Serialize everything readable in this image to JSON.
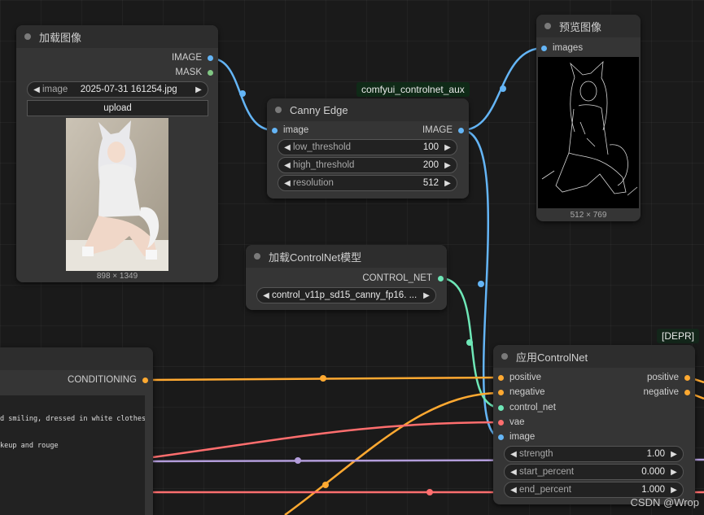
{
  "colors": {
    "image": "#64b5f6",
    "mask": "#81c784",
    "control_net": "#6ee7b7",
    "conditioning": "#ffa931",
    "vae": "#ff6e6e",
    "clip": "#b39ddb",
    "node_bg": "#353535",
    "canvas_bg": "#1a1a1a"
  },
  "load_image_node": {
    "title": "加载图像",
    "outputs": [
      "IMAGE",
      "MASK"
    ],
    "image_widget": {
      "label": "image",
      "value": "2025-07-31 161254.jpg"
    },
    "upload_label": "upload",
    "preview_dims": "898 × 1349"
  },
  "canny_node": {
    "badge": "comfyui_controlnet_aux",
    "title": "Canny Edge",
    "input": "image",
    "output": "IMAGE",
    "widgets": [
      {
        "label": "low_threshold",
        "value": "100"
      },
      {
        "label": "high_threshold",
        "value": "200"
      },
      {
        "label": "resolution",
        "value": "512"
      }
    ]
  },
  "preview_node": {
    "title": "预览图像",
    "input": "images",
    "preview_dims": "512 × 769"
  },
  "load_controlnet_node": {
    "title": "加载ControlNet模型",
    "output": "CONTROL_NET",
    "model_widget": {
      "value": "control_v11p_sd15_canny_fp16. ..."
    }
  },
  "text_encode_node": {
    "output": "CONDITIONING",
    "text_lines": [
      "d smiling, dressed in white clothes,",
      "keup and rouge"
    ]
  },
  "apply_controlnet_node": {
    "badge": "[DEPR]",
    "title": "应用ControlNet",
    "inputs": [
      "positive",
      "negative",
      "control_net",
      "vae",
      "image"
    ],
    "outputs": [
      "positive",
      "negative"
    ],
    "widgets": [
      {
        "label": "strength",
        "value": "1.00"
      },
      {
        "label": "start_percent",
        "value": "0.000"
      },
      {
        "label": "end_percent",
        "value": "1.000"
      }
    ]
  },
  "watermark": "CSDN @Wrop"
}
